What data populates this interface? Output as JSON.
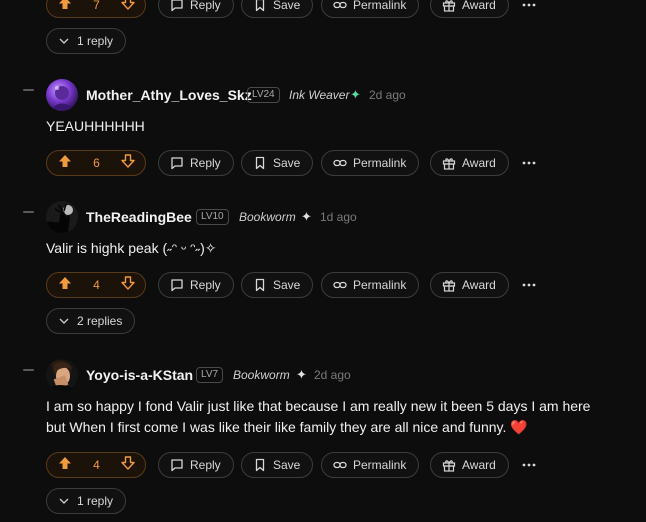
{
  "labels": {
    "reply": "Reply",
    "save": "Save",
    "permalink": "Permalink",
    "award": "Award"
  },
  "colors": {
    "accent": "#f09a3e",
    "sparkle_green": "#58d6a2",
    "heart": "#e0383e"
  },
  "top_partial": {
    "vote_count": "7",
    "thread_toggle": "1 reply"
  },
  "comments": [
    {
      "username": "Mother_Athy_Loves_Skz",
      "level": "LV24",
      "title": "Ink Weaver",
      "sparkle": "✦",
      "time": "2d ago",
      "text": "YEAUHHHHHH",
      "votes": "6",
      "thread_toggle": ""
    },
    {
      "username": "TheReadingBee",
      "level": "LV10",
      "title": "Bookworm",
      "sparkle": "✦",
      "time": "1d ago",
      "text": "Valir is highk peak (˶ᵔ ᵕ ᵔ˶)✧",
      "votes": "4",
      "thread_toggle": "2 replies"
    },
    {
      "username": "Yoyo-is-a-KStan",
      "level": "LV7",
      "title": "Bookworm",
      "sparkle": "✦",
      "time": "2d ago",
      "text_line1": "I am so happy I fond Valir just like that because I am really new it been 5 days I am here",
      "text_line2": "but When I first come I was like their like family they are all nice and funny.",
      "heart": "❤️",
      "votes": "4",
      "thread_toggle": "1 reply"
    }
  ]
}
